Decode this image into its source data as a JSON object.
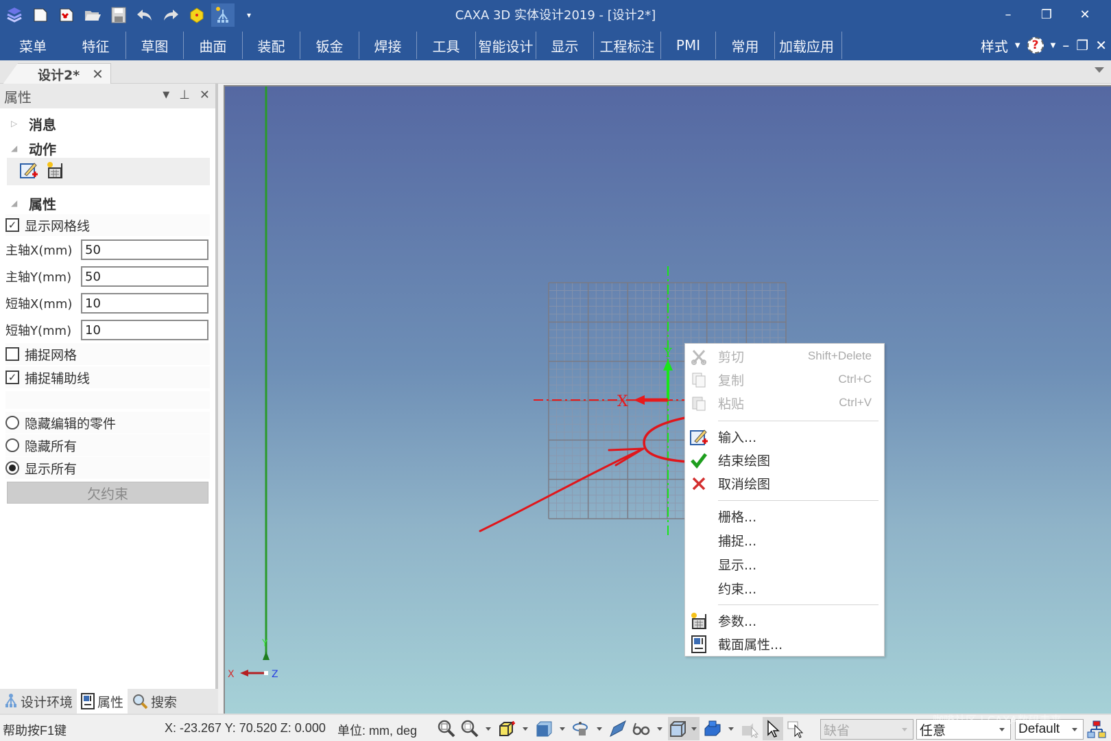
{
  "window": {
    "title": "CAXA 3D 实体设计2019 - [设计2*]",
    "controls": {
      "minimize": "–",
      "restore": "❐",
      "close": "✕"
    }
  },
  "quick_access": [
    {
      "icon": "app-logo-icon"
    },
    {
      "icon": "new-file-icon"
    },
    {
      "icon": "new-drawing-icon"
    },
    {
      "icon": "open-folder-icon"
    },
    {
      "icon": "save-icon"
    },
    {
      "icon": "undo-icon"
    },
    {
      "icon": "redo-icon"
    },
    {
      "icon": "component-icon"
    },
    {
      "icon": "design-tree-icon"
    },
    {
      "icon": "customize-qat-icon"
    }
  ],
  "ribbon": {
    "tabs": [
      "菜单",
      "特征",
      "草图",
      "曲面",
      "装配",
      "钣金",
      "焊接",
      "工具",
      "智能设计",
      "显示",
      "工程标注",
      "PMI",
      "常用",
      "加载应用"
    ],
    "style_label": "样式",
    "help_glyph": "?",
    "mdi_controls": {
      "minimize": "–",
      "restore": "❐",
      "close": "✕"
    }
  },
  "doc_tabs": [
    {
      "label": "设计2*",
      "close": "✕",
      "active": true
    }
  ],
  "panel": {
    "title": "属性",
    "sections": {
      "message": "消息",
      "action": "动作",
      "properties": "属性"
    },
    "show_grid": {
      "label": "显示网格线",
      "checked": true
    },
    "fields": [
      {
        "label": "主轴X(mm)",
        "value": "50"
      },
      {
        "label": "主轴Y(mm)",
        "value": "50"
      },
      {
        "label": "短轴X(mm)",
        "value": "10"
      },
      {
        "label": "短轴Y(mm)",
        "value": "10"
      }
    ],
    "snap_grid": {
      "label": "捕捉网格",
      "checked": false
    },
    "snap_guides": {
      "label": "捕捉辅助线",
      "checked": true
    },
    "visibility": [
      {
        "label": "隐藏编辑的零件",
        "selected": false
      },
      {
        "label": "隐藏所有",
        "selected": false
      },
      {
        "label": "显示所有",
        "selected": true
      }
    ],
    "underconstrained_button": "欠约束",
    "bottom_tabs": [
      {
        "label": "设计环境",
        "icon": "design-env-icon",
        "active": false
      },
      {
        "label": "属性",
        "icon": "properties-icon",
        "active": true
      },
      {
        "label": "搜索",
        "icon": "search-icon",
        "active": false
      }
    ]
  },
  "viewport": {
    "axis_labels": {
      "x": "X",
      "y": "Y"
    },
    "triad": {
      "x": "X",
      "y": "Y",
      "z": "Z"
    }
  },
  "context_menu": {
    "items": [
      {
        "label": "剪切",
        "shortcut": "Shift+Delete",
        "icon": "cut-icon",
        "disabled": true
      },
      {
        "label": "复制",
        "shortcut": "Ctrl+C",
        "icon": "copy-icon",
        "disabled": true
      },
      {
        "label": "粘贴",
        "shortcut": "Ctrl+V",
        "icon": "paste-icon",
        "disabled": true
      },
      {
        "label": "输入...",
        "icon": "input-sketch-icon",
        "disabled": false,
        "highlighted_annotation": true
      },
      {
        "label": "结束绘图",
        "icon": "checkmark-icon",
        "disabled": false
      },
      {
        "label": "取消绘图",
        "icon": "cancel-x-icon",
        "disabled": false
      },
      {
        "label": "栅格...",
        "disabled": false
      },
      {
        "label": "捕捉...",
        "disabled": false
      },
      {
        "label": "显示...",
        "disabled": false
      },
      {
        "label": "约束...",
        "disabled": false
      },
      {
        "label": "参数...",
        "icon": "parameters-icon",
        "disabled": false
      },
      {
        "label": "截面属性...",
        "icon": "section-properties-icon",
        "disabled": false
      }
    ]
  },
  "statusbar": {
    "help": "帮助按F1键",
    "coords": "X: -23.267 Y: 70.520 Z: 0.000",
    "units": "单位: mm, deg",
    "filter_combo": "缺省",
    "select_combo": "任意",
    "style_combo": "Default"
  },
  "watermark": "咖啡社区 | CAXA数码未来",
  "colors": {
    "title_bar": "#2b579a",
    "annotation_red": "#e0161b",
    "axis_green": "#19e619",
    "axis_red": "#e8191b"
  }
}
